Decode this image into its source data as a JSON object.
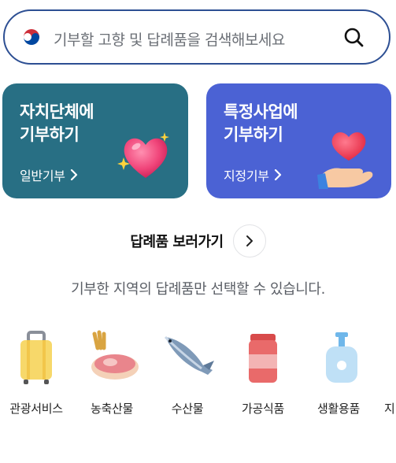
{
  "search": {
    "placeholder": "기부할 고향 및 답례품을 검색해보세요"
  },
  "cards": [
    {
      "title_line1": "자치단체에",
      "title_line2": "기부하기",
      "link": "일반기부",
      "color": "#286f84"
    },
    {
      "title_line1": "특정사업에",
      "title_line2": "기부하기",
      "link": "지정기부",
      "color": "#4b62d4"
    }
  ],
  "gifts": {
    "label": "답례품 보러가기"
  },
  "info_text": "기부한 지역의 답례품만 선택할 수 있습니다.",
  "categories": [
    {
      "label": "관광서비스",
      "icon": "suitcase-icon"
    },
    {
      "label": "농축산물",
      "icon": "meat-grain-icon"
    },
    {
      "label": "수산물",
      "icon": "fish-icon"
    },
    {
      "label": "가공식품",
      "icon": "can-icon"
    },
    {
      "label": "생활용품",
      "icon": "pump-bottle-icon"
    },
    {
      "label": "지",
      "icon": ""
    }
  ]
}
